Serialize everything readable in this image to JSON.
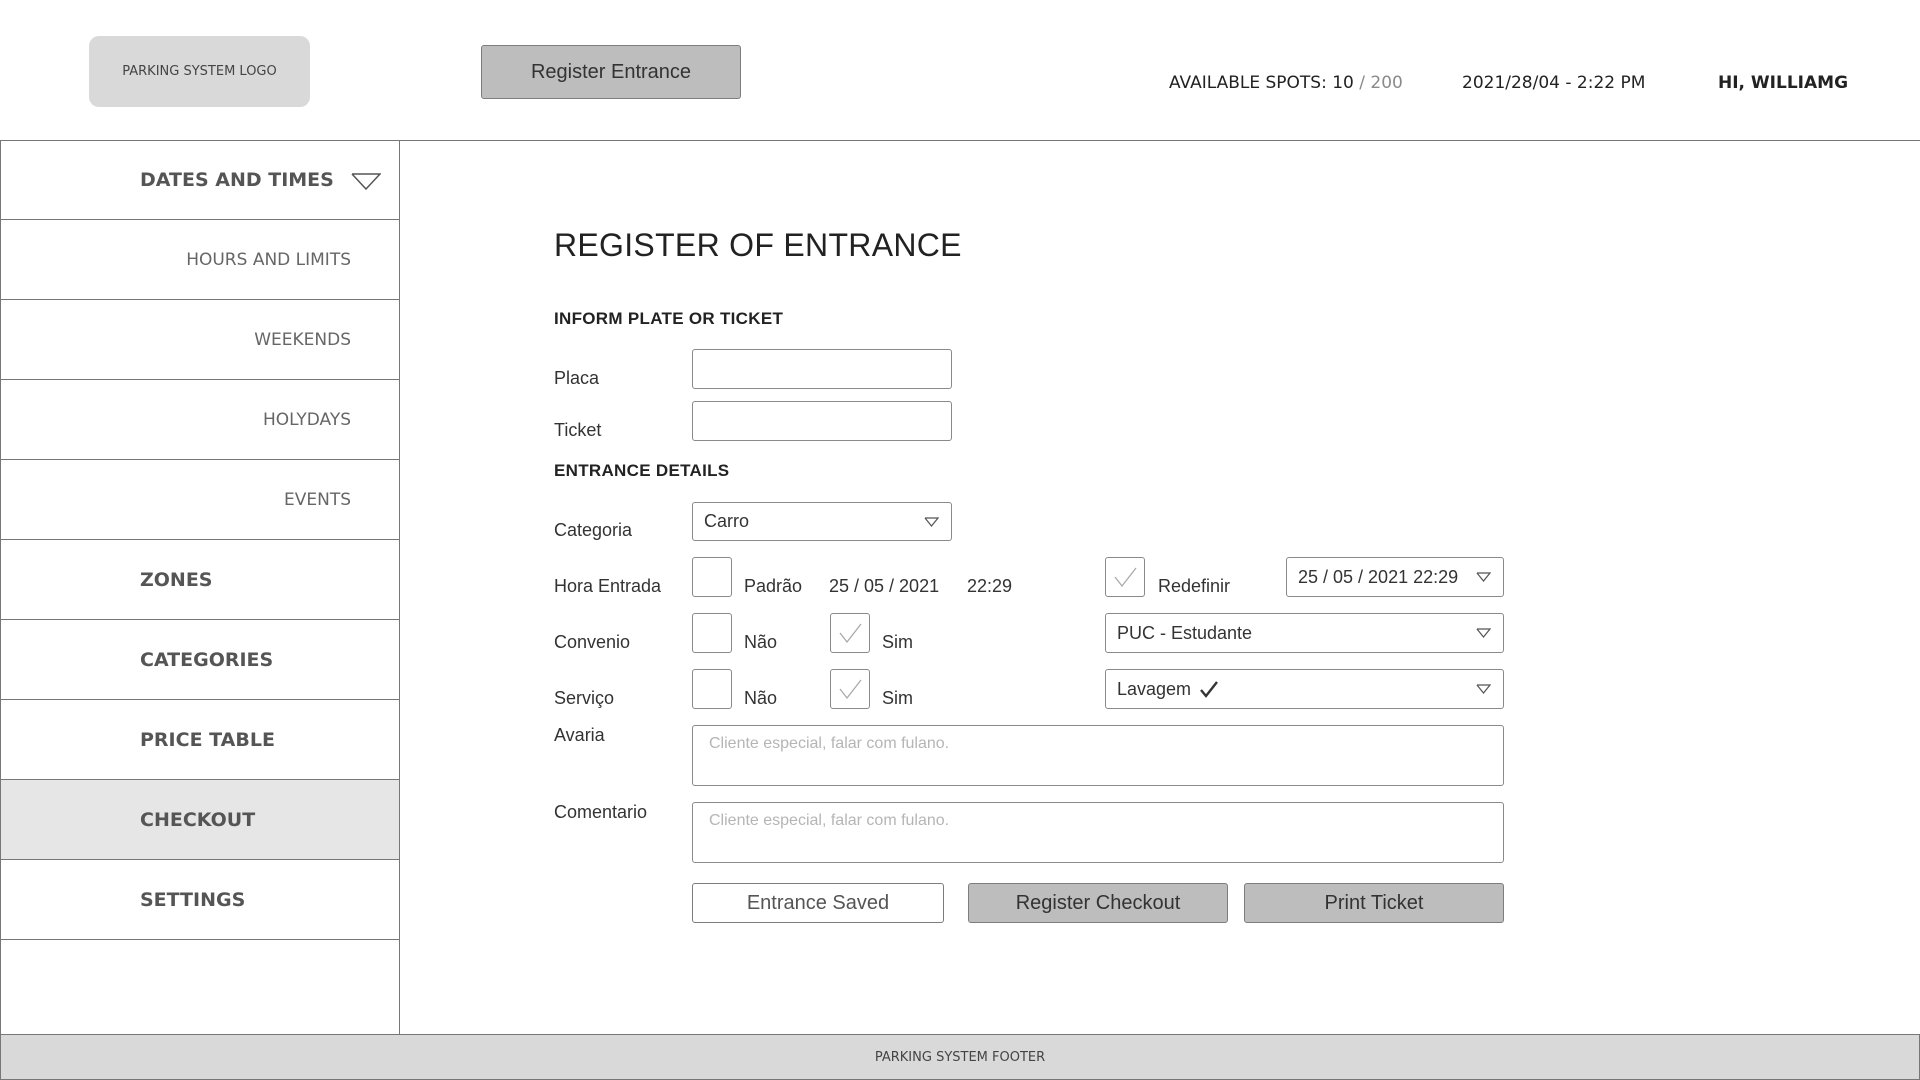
{
  "header": {
    "logo_text": "PARKING SYSTEM LOGO",
    "register_entrance_label": "Register Entrance",
    "spots_label": "AVAILABLE SPOTS:",
    "spots_available": "10",
    "spots_total": "/ 200",
    "datetime": "2021/28/04 - 2:22 PM",
    "greeting": "HI, WILLIAMG"
  },
  "sidebar": {
    "items": [
      {
        "label": "DATES AND TIMES"
      },
      {
        "label": "HOURS AND LIMITS"
      },
      {
        "label": "WEEKENDS"
      },
      {
        "label": "HOLYDAYS"
      },
      {
        "label": "EVENTS"
      },
      {
        "label": "ZONES"
      },
      {
        "label": "CATEGORIES"
      },
      {
        "label": "PRICE TABLE"
      },
      {
        "label": "CHECKOUT"
      },
      {
        "label": "SETTINGS"
      }
    ]
  },
  "form": {
    "title": "REGISTER OF ENTRANCE",
    "section_plate": "INFORM PLATE OR TICKET",
    "placa_label": "Placa",
    "placa_value": "",
    "ticket_label": "Ticket",
    "ticket_value": "",
    "section_details": "ENTRANCE DETAILS",
    "categoria_label": "Categoria",
    "categoria_value": "Carro",
    "hora_label": "Hora Entrada",
    "padrao_label": "Padrão",
    "padrao_checked": false,
    "padrao_date": "25 / 05 / 2021",
    "padrao_time": "22:29",
    "redefinir_label": "Redefinir",
    "redefinir_checked": true,
    "redefinir_value": "25 / 05 / 2021 22:29",
    "convenio_label": "Convenio",
    "convenio_nao_label": "Não",
    "convenio_nao_checked": false,
    "convenio_sim_label": "Sim",
    "convenio_sim_checked": true,
    "convenio_value": "PUC - Estudante",
    "servico_label": "Serviço",
    "servico_nao_label": "Não",
    "servico_nao_checked": false,
    "servico_sim_label": "Sim",
    "servico_sim_checked": true,
    "servico_value": "Lavagem",
    "avaria_label": "Avaria",
    "avaria_placeholder": "Cliente especial, falar com fulano.",
    "comentario_label": "Comentario",
    "comentario_placeholder": "Cliente especial, falar com fulano.",
    "btn_saved": "Entrance Saved",
    "btn_checkout": "Register Checkout",
    "btn_print": "Print Ticket"
  },
  "footer": {
    "text": "PARKING SYSTEM FOOTER"
  }
}
